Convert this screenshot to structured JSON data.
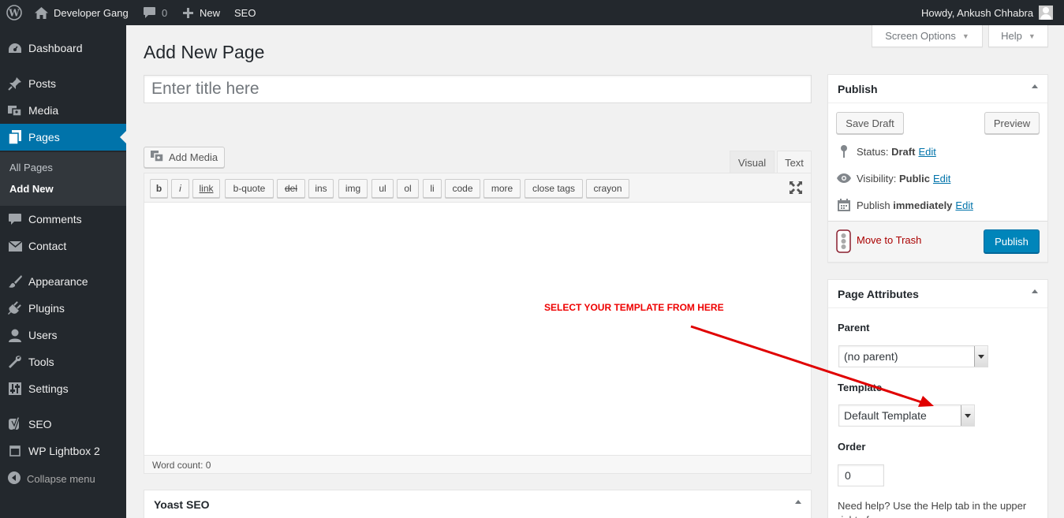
{
  "adminbar": {
    "site_name": "Developer Gang",
    "comments_count": "0",
    "new_label": "New",
    "seo_label": "SEO",
    "howdy": "Howdy, Ankush Chhabra"
  },
  "sidebar": {
    "items": [
      {
        "label": "Dashboard",
        "icon": "dashboard-icon"
      },
      {
        "label": "Posts",
        "icon": "pin-icon"
      },
      {
        "label": "Media",
        "icon": "media-icon"
      },
      {
        "label": "Pages",
        "icon": "pages-icon"
      },
      {
        "label": "Comments",
        "icon": "comment-icon"
      },
      {
        "label": "Contact",
        "icon": "mail-icon"
      },
      {
        "label": "Appearance",
        "icon": "brush-icon"
      },
      {
        "label": "Plugins",
        "icon": "plugin-icon"
      },
      {
        "label": "Users",
        "icon": "user-icon"
      },
      {
        "label": "Tools",
        "icon": "wrench-icon"
      },
      {
        "label": "Settings",
        "icon": "settings-icon"
      },
      {
        "label": "SEO",
        "icon": "yoast-icon"
      },
      {
        "label": "WP Lightbox 2",
        "icon": "lightbox-icon"
      }
    ],
    "submenu": [
      "All Pages",
      "Add New"
    ],
    "collapse": "Collapse menu"
  },
  "header": {
    "title": "Add New Page",
    "screen_options": "Screen Options",
    "help": "Help"
  },
  "editor": {
    "title_placeholder": "Enter title here",
    "add_media": "Add Media",
    "tab_visual": "Visual",
    "tab_text": "Text",
    "quicktags": [
      "b",
      "i",
      "link",
      "b-quote",
      "del",
      "ins",
      "img",
      "ul",
      "ol",
      "li",
      "code",
      "more",
      "close tags",
      "crayon"
    ],
    "word_count": "Word count: 0"
  },
  "publish": {
    "title": "Publish",
    "save_draft": "Save Draft",
    "preview": "Preview",
    "status_label": "Status:",
    "status_value": "Draft",
    "visibility_label": "Visibility:",
    "visibility_value": "Public",
    "publish_label": "Publish",
    "publish_value": "immediately",
    "edit": "Edit",
    "trash": "Move to Trash",
    "publish_button": "Publish"
  },
  "attributes": {
    "title": "Page Attributes",
    "parent_label": "Parent",
    "parent_value": "(no parent)",
    "template_label": "Template",
    "template_value": "Default Template",
    "order_label": "Order",
    "order_value": "0",
    "help_text": "Need help? Use the Help tab in the upper right of your screen."
  },
  "yoast": {
    "title": "Yoast SEO"
  },
  "annotation": "SELECT YOUR TEMPLATE FROM HERE",
  "colors": {
    "adminbar": "#23282d",
    "accent": "#0073aa",
    "annotation": "#e00000"
  }
}
